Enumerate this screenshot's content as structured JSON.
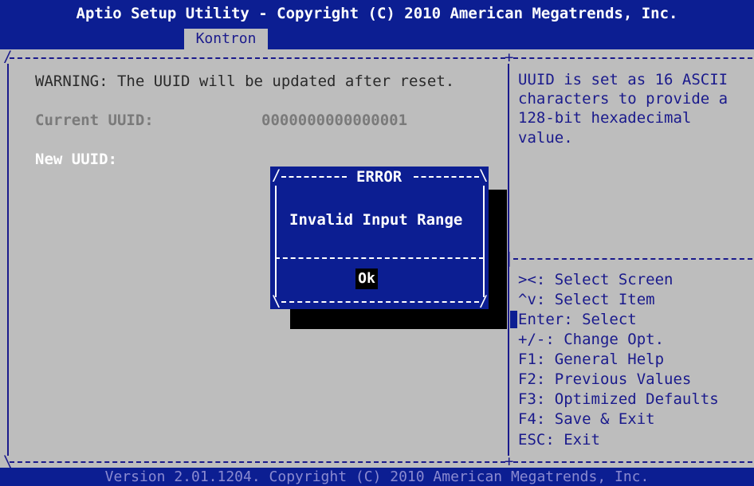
{
  "header": {
    "title": "Aptio Setup Utility - Copyright (C) 2010 American Megatrends, Inc.",
    "active_tab": "Kontron"
  },
  "main": {
    "warning": "WARNING: The UUID will be updated after reset.",
    "current_uuid_label": "Current UUID:",
    "current_uuid_value": "0000000000000001",
    "new_uuid_label": "New UUID:"
  },
  "help": {
    "lines": [
      "UUID is set as 16 ASCII",
      "characters to provide a",
      "128-bit hexadecimal",
      "value."
    ]
  },
  "keys": [
    "><: Select Screen",
    "^v: Select Item",
    "Enter: Select",
    "+/-: Change Opt.",
    "F1: General Help",
    "F2: Previous Values",
    "F3: Optimized Defaults",
    "F4: Save & Exit",
    "ESC: Exit"
  ],
  "dialog": {
    "title": "ERROR",
    "message": "Invalid Input Range",
    "ok_label": "Ok"
  },
  "footer": {
    "text": "Version 2.01.1204. Copyright (C) 2010 American Megatrends, Inc."
  },
  "colors": {
    "bios_blue": "#0c1e92",
    "background_gray": "#bdbdbd",
    "text_blue": "#1a1a8c"
  }
}
